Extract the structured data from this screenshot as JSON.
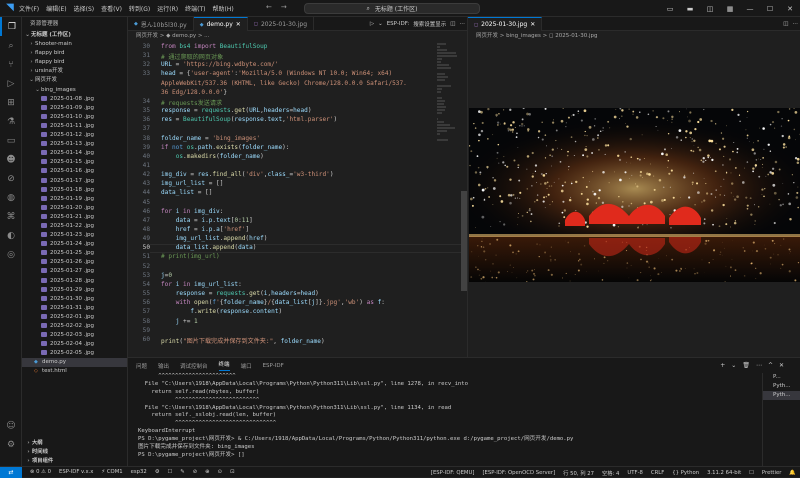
{
  "titlebar": {
    "menu": [
      "文件(F)",
      "编辑(E)",
      "选择(S)",
      "查看(V)",
      "转到(G)",
      "运行(R)",
      "终端(T)",
      "帮助(H)"
    ],
    "search": "无标题 (工作区)"
  },
  "sidebar": {
    "title": "资源管理器",
    "workspace": "无标题 (工作区)",
    "folders": [
      "Shooter-main",
      "flappy bird",
      "flappy bird",
      "ursina开发",
      "网页开发"
    ],
    "subfolder": "bing_images",
    "images": [
      "2025-01-08 .jpg",
      "2025-01-09 .jpg",
      "2025-01-10 .jpg",
      "2025-01-11 .jpg",
      "2025-01-12 .jpg",
      "2025-01-13 .jpg",
      "2025-01-14 .jpg",
      "2025-01-15 .jpg",
      "2025-01-16 .jpg",
      "2025-01-17 .jpg",
      "2025-01-18 .jpg",
      "2025-01-19 .jpg",
      "2025-01-20 .jpg",
      "2025-01-21 .jpg",
      "2025-01-22 .jpg",
      "2025-01-23 .jpg",
      "2025-01-24 .jpg",
      "2025-01-25 .jpg",
      "2025-01-26 .jpg",
      "2025-01-27 .jpg",
      "2025-01-28 .jpg",
      "2025-01-29 .jpg",
      "2025-01-30 .jpg",
      "2025-01-31 .jpg",
      "2025-02-01 .jpg",
      "2025-02-02 .jpg",
      "2025-02-03 .jpg",
      "2025-02-04 .jpg",
      "2025-02-05 .jpg"
    ],
    "files": [
      "demo.py",
      "test.html"
    ],
    "bottom": [
      "大纲",
      "时间线",
      "项目组件"
    ]
  },
  "editor_tabs": [
    "恩ん10b5l30.py",
    "demo.py",
    "2025-01-30.jpg"
  ],
  "tab_tools": [
    "ESP-IDF:",
    "搜索设置显示"
  ],
  "breadcrumb_left": "网页开发 > ◆ demo.py > ...",
  "code_lines": [
    {
      "n": "30",
      "html": "<span class=\"k\">from</span> <span class=\"t\">bs4</span> <span class=\"k\">import</span> <span class=\"t\">BeautifulSoup</span>"
    },
    {
      "n": "31",
      "html": "<span class=\"c\"># 通过爬取的网页对象</span>"
    },
    {
      "n": "32",
      "html": "<span class=\"v\">URL</span> = <span class=\"s\">'https://bing.wdbyte.com/'</span>"
    },
    {
      "n": "33",
      "html": "<span class=\"v\">head</span> = {<span class=\"s\">'user-agent'</span>:<span class=\"s\">'Mozilla/5.0 (Windows NT 10.0; Win64; x64)</span>"
    },
    {
      "n": "",
      "html": "<span class=\"s\">AppleWebKit/537.36 (KHTML, like Gecko) Chrome/128.0.0.0 Safari/537.</span>"
    },
    {
      "n": "",
      "html": "<span class=\"s\">36 Edg/128.0.0.0'</span>}"
    },
    {
      "n": "34",
      "html": "<span class=\"c\"># requests发送请求</span>"
    },
    {
      "n": "35",
      "html": "<span class=\"v\">response</span> = <span class=\"t\">requests</span>.<span class=\"f\">get</span>(<span class=\"v\">URL</span>,<span class=\"v\">headers</span>=<span class=\"v\">head</span>)"
    },
    {
      "n": "36",
      "html": "<span class=\"v\">res</span> = <span class=\"t\">BeautifulSoup</span>(<span class=\"v\">response</span>.<span class=\"v\">text</span>,<span class=\"s\">'html.parser'</span>)"
    },
    {
      "n": "37",
      "html": ""
    },
    {
      "n": "38",
      "html": "<span class=\"v\">folder_name</span> = <span class=\"s\">'bing_images'</span>"
    },
    {
      "n": "39",
      "html": "<span class=\"k\">if</span> <span class=\"b\">not</span> <span class=\"t\">os</span>.<span class=\"v\">path</span>.<span class=\"f\">exists</span>(<span class=\"v\">folder_name</span>):"
    },
    {
      "n": "40",
      "html": "    <span class=\"t\">os</span>.<span class=\"f\">makedirs</span>(<span class=\"v\">folder_name</span>)"
    },
    {
      "n": "41",
      "html": ""
    },
    {
      "n": "42",
      "html": "<span class=\"v\">img_div</span> = <span class=\"v\">res</span>.<span class=\"f\">find_all</span>(<span class=\"s\">'div'</span>,<span class=\"v\">class_</span>=<span class=\"s\">'w3-third'</span>)"
    },
    {
      "n": "43",
      "html": "<span class=\"v\">img_url_list</span> = []"
    },
    {
      "n": "44",
      "html": "<span class=\"v\">data_list</span> = []"
    },
    {
      "n": "45",
      "html": ""
    },
    {
      "n": "46",
      "html": "<span class=\"k\">for</span> <span class=\"v\">i</span> <span class=\"k\">in</span> <span class=\"v\">img_div</span>:"
    },
    {
      "n": "47",
      "html": "    <span class=\"v\">data</span> = <span class=\"v\">i</span>.<span class=\"v\">p</span>.<span class=\"v\">text</span>[<span class=\"n\">0</span>:<span class=\"n\">11</span>]"
    },
    {
      "n": "48",
      "html": "    <span class=\"v\">href</span> = <span class=\"v\">i</span>.<span class=\"v\">p</span>.<span class=\"v\">a</span>[<span class=\"s\">'href'</span>]"
    },
    {
      "n": "49",
      "html": "    <span class=\"v\">img_url_list</span>.<span class=\"f\">append</span>(<span class=\"v\">href</span>)"
    },
    {
      "n": "50",
      "html": "    <span class=\"v\">data_list</span>.<span class=\"f\">append</span>(<span class=\"v\">data</span>)"
    },
    {
      "n": "51",
      "html": "<span class=\"c\"># print(img_url)</span>"
    },
    {
      "n": "52",
      "html": ""
    },
    {
      "n": "53",
      "html": "<span class=\"v\">j</span>=<span class=\"n\">0</span>"
    },
    {
      "n": "54",
      "html": "<span class=\"k\">for</span> <span class=\"v\">i</span> <span class=\"k\">in</span> <span class=\"v\">img_url_list</span>:"
    },
    {
      "n": "55",
      "html": "    <span class=\"v\">response</span> = <span class=\"t\">requests</span>.<span class=\"f\">get</span>(<span class=\"v\">i</span>,<span class=\"v\">headers</span>=<span class=\"v\">head</span>)"
    },
    {
      "n": "56",
      "html": "    <span class=\"k\">with</span> <span class=\"f\">open</span>(<span class=\"b\">f</span><span class=\"s\">'</span>{<span class=\"v\">folder_name</span>}<span class=\"s\">/</span>{<span class=\"v\">data_list</span>[<span class=\"v\">j</span>]}<span class=\"s\">.jpg'</span>,<span class=\"s\">'wb'</span>) <span class=\"k\">as</span> <span class=\"v\">f</span>:"
    },
    {
      "n": "57",
      "html": "        <span class=\"v\">f</span>.<span class=\"f\">write</span>(<span class=\"v\">response</span>.<span class=\"v\">content</span>)"
    },
    {
      "n": "58",
      "html": "    <span class=\"v\">j</span> += <span class=\"n\">1</span>"
    },
    {
      "n": "59",
      "html": ""
    },
    {
      "n": "60",
      "html": "<span class=\"f\">print</span>(<span class=\"s\">\"图片下载完成并保存到文件夹:\"</span>, <span class=\"v\">folder_name</span>)"
    }
  ],
  "current_line": "50",
  "breadcrumb_right": "网页开发 > bing_images > ◻ 2025-01-30.jpg",
  "preview_tab": "2025-01-30.jpg",
  "panel_tabs": [
    "问题",
    "输出",
    "调试控制台",
    "终端",
    "端口",
    "ESP-IDF"
  ],
  "terminal_lines": [
    "      ^^^^^^^^^^^^^^^^^^^^^^^",
    "  File \"C:\\Users\\1918\\AppData\\Local\\Programs\\Python\\Python311\\Lib\\ssl.py\", line 1278, in recv_into",
    "    return self.read(nbytes, buffer)",
    "           ^^^^^^^^^^^^^^^^^^^^^^^^^",
    "  File \"C:\\Users\\1918\\AppData\\Local\\Programs\\Python\\Python311\\Lib\\ssl.py\", line 1134, in read",
    "    return self._sslobj.read(len, buffer)",
    "           ^^^^^^^^^^^^^^^^^^^^^^^^^^^^^^",
    "KeyboardInterrupt",
    "PS D:\\pygame_project\\网页开发> & C:/Users/1918/AppData/Local/Programs/Python/Python311/python.exe d:/pygame_project/网页开发/demo.py",
    "图片下载完成并保存到文件夹: bing_images",
    "PS D:\\pygame_project\\网页开发> []"
  ],
  "terminal_list": [
    "P...",
    "Pyth...",
    "Pyth..."
  ],
  "status_left": [
    "⊗ 0 ⚠ 0",
    "ESP-IDF v.x.x",
    "⚡ COM1",
    "esp32",
    "⚙",
    "☐",
    "✎",
    "⊘",
    "⊕",
    "⊙",
    "⊡"
  ],
  "status_right": [
    "[ESP-IDF: QEMU]",
    "[ESP-IDF: OpenOCD Server]",
    "行 50, 列 27",
    "空格: 4",
    "UTF-8",
    "CRLF",
    "{} Python",
    "3.11.2 64-bit",
    "☐",
    "Prettier",
    "🔔"
  ]
}
